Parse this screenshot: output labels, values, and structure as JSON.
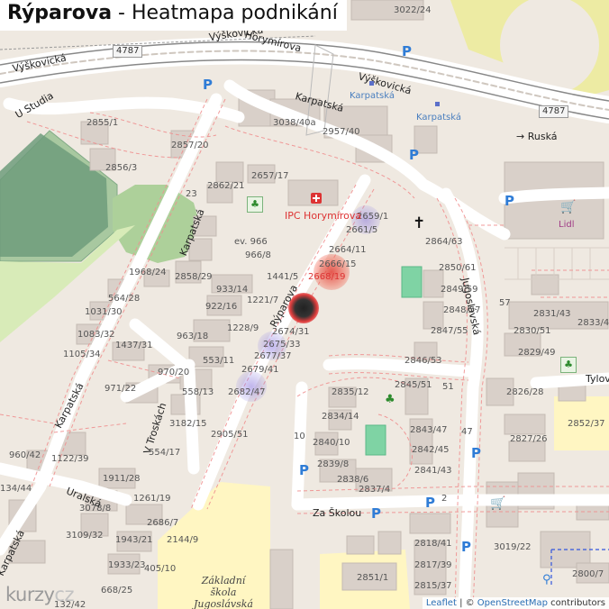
{
  "header": {
    "street": "Rýparova",
    "title_rest": " - Heatmapa podnikání"
  },
  "colors": {
    "background": "#efe9e1",
    "road": "#ffffff",
    "cemetery": "#5b9a6f",
    "park": "#b5d29c",
    "school": "#fff7c4",
    "parking_blue": "#2f7cd6",
    "heat_hot": "#d9281c",
    "heat_cool": "#8a7fd6"
  },
  "streets": {
    "vyskovicka_1": "Výškovická",
    "vyskovicka_2": "Výškovická",
    "vyskovicka_3": "Výškovická",
    "horymirova": "Horymírova",
    "karpatska_1": "Karpatská",
    "karpatska_2": "Karpatská",
    "karpatska_3": "Karpatská",
    "karpatska_4": "Karpatská",
    "karpatska_stop_1": "Karpatská",
    "karpatska_stop_2": "Karpatská",
    "u_studia": "U Studia",
    "ruska": "→ Ruská",
    "jugoslavska": "Jugoslávská",
    "ryparova": "Rýparova",
    "uralska": "Uralská",
    "v_trosakach": "V Troskách",
    "za_skolou": "Za Školou",
    "tylova": "Tylov"
  },
  "road_refs": {
    "ref_left": "4787",
    "ref_right": "4787"
  },
  "pois": {
    "ipc": "IPC Horymírova",
    "lidl": "Lidl",
    "school_line1": "Základní",
    "school_line2": "škola Jugoslávská"
  },
  "house_numbers": {
    "n3022": "3022/24",
    "n2855": "2855/1",
    "n2857": "2857/20",
    "n2856": "2856/3",
    "n3038": "3038/40a",
    "n2957": "2957/40",
    "n2862": "2862/21",
    "n2657": "2657/17",
    "n23": "23",
    "n2659": "2659/1",
    "n2661": "2661/5",
    "n2864": "2864/63",
    "nev966": "ev. 966",
    "n966": "966/8",
    "n2664": "2664/11",
    "n2850": "2850/61",
    "n1968": "1968/24",
    "n2858": "2858/29",
    "n1441": "1441/5",
    "n2666": "2666/15",
    "n2668": "2668/19",
    "n564": "564/28",
    "n933": "933/14",
    "n2849": "2849/59",
    "n1031": "1031/30",
    "n922": "922/16",
    "n1221": "1221/7",
    "n57": "57",
    "n2848": "2848/57",
    "n2831": "2831/43",
    "n2833": "2833/4",
    "n1083": "1083/32",
    "n963": "963/18",
    "n1228": "1228/9",
    "n2674": "2674/31",
    "n2830": "2830/51",
    "n2847": "2847/55",
    "n1105": "1105/34",
    "n1437": "1437/31",
    "n2675": "2675/33",
    "n2829": "2829/49",
    "n553": "553/11",
    "n2677": "2677/37",
    "n2846": "2846/53",
    "n970": "970/20",
    "n2679": "2679/41",
    "n971": "971/22",
    "n558": "558/13",
    "n2682": "2682/47",
    "n2845": "2845/51",
    "n51": "51",
    "n2835": "2835/12",
    "n2826": "2826/28",
    "n2834": "2834/14",
    "n3182": "3182/15",
    "n2852": "2852/37",
    "n2843": "2843/47",
    "n47": "47",
    "n2905": "2905/51",
    "n10": "10",
    "n2840": "2840/10",
    "n2842": "2842/45",
    "n2827": "2827/26",
    "n960": "960/42",
    "n1122": "1122/39",
    "n554": "554/17",
    "n2839": "2839/8",
    "n2841": "2841/43",
    "n1911": "1911/28",
    "n134": "134/44",
    "n2838": "2838/6",
    "n2837": "2837/4",
    "n3078": "3078/8",
    "n1261": "1261/19",
    "n2": "2",
    "n2686": "2686/7",
    "n3109": "3109/32",
    "n1943": "1943/21",
    "n2144": "2144/9",
    "n2818": "2818/41",
    "n3019": "3019/22",
    "n2800": "2800/7",
    "n1933": "1933/23",
    "n405": "405/10",
    "n2851": "2851/1",
    "n2817": "2817/39",
    "n668": "668/25",
    "n2815": "2815/37",
    "n132": "132/42"
  },
  "attribution": {
    "leaflet": "Leaflet",
    "sep": " | © ",
    "osm": "OpenStreetMap",
    "contrib": " contributors"
  },
  "logo": {
    "text_1": "kurzy",
    "text_2": "cz"
  },
  "heatmap": [
    {
      "label": "2668/19",
      "intensity": 1.0
    },
    {
      "label": "2666/15",
      "intensity": 0.75
    },
    {
      "label": "2659/1",
      "intensity": 0.35
    },
    {
      "label": "2675/33",
      "intensity": 0.3
    },
    {
      "label": "2682/47",
      "intensity": 0.3
    },
    {
      "label": "2674/31",
      "intensity": 0.95
    }
  ]
}
